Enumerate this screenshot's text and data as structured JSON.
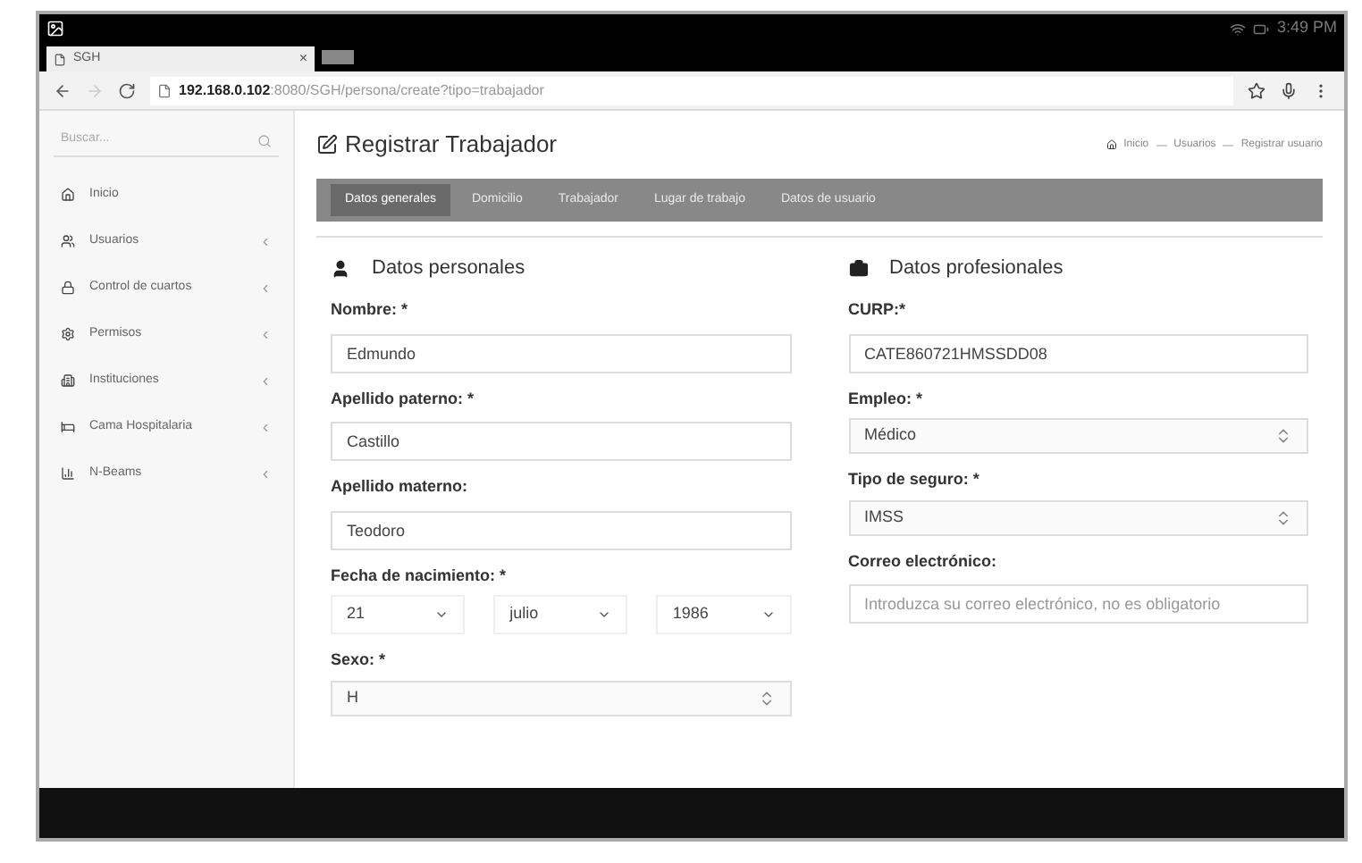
{
  "status_bar": {
    "time": "3:49 PM"
  },
  "browser": {
    "tab_title": "SGH",
    "close": "×",
    "url_host": "192.168.0.102",
    "url_path": ":8080/SGH/persona/create?tipo=trabajador"
  },
  "sidebar": {
    "search": {
      "placeholder": "Buscar..."
    },
    "items": [
      {
        "label": "Inicio",
        "expandable": false
      },
      {
        "label": "Usuarios",
        "expandable": true
      },
      {
        "label": "Control de cuartos",
        "expandable": true
      },
      {
        "label": "Permisos",
        "expandable": true
      },
      {
        "label": "Instituciones",
        "expandable": true
      },
      {
        "label": "Cama Hospitalaria",
        "expandable": true
      },
      {
        "label": "N-Beams",
        "expandable": true
      }
    ]
  },
  "page": {
    "title": "Registrar Trabajador",
    "breadcrumb": [
      "Inicio",
      "Usuarios",
      "Registrar usuario"
    ]
  },
  "tabs": [
    {
      "label": "Datos generales",
      "selected": true
    },
    {
      "label": "Domicilio",
      "selected": false
    },
    {
      "label": "Trabajador",
      "selected": false
    },
    {
      "label": "Lugar de trabajo",
      "selected": false
    },
    {
      "label": "Datos de usuario",
      "selected": false
    }
  ],
  "sections": [
    {
      "title": "Datos personales",
      "fields": [
        {
          "kind": "text",
          "label": "Nombre: *",
          "value": "Edmundo"
        },
        {
          "kind": "text",
          "label": "Apellido paterno: *",
          "value": "Castillo"
        },
        {
          "kind": "text",
          "label": "Apellido materno:",
          "value": "Teodoro"
        },
        {
          "kind": "date",
          "label": "Fecha de nacimiento: *",
          "parts": [
            "21",
            "julio",
            "1986"
          ]
        },
        {
          "kind": "select",
          "label": "Sexo: *",
          "value": "H"
        }
      ]
    },
    {
      "title": "Datos profesionales",
      "fields": [
        {
          "kind": "text",
          "label": "CURP:*",
          "value": "CATE860721HMSSDD08"
        },
        {
          "kind": "select",
          "label": "Empleo: *",
          "value": "Médico"
        },
        {
          "kind": "select",
          "label": "Tipo de seguro: *",
          "value": "IMSS"
        },
        {
          "kind": "text",
          "label": "Correo electrónico:",
          "placeholder": "Introduzca su correo electrónico, no es obligatorio"
        }
      ]
    }
  ]
}
